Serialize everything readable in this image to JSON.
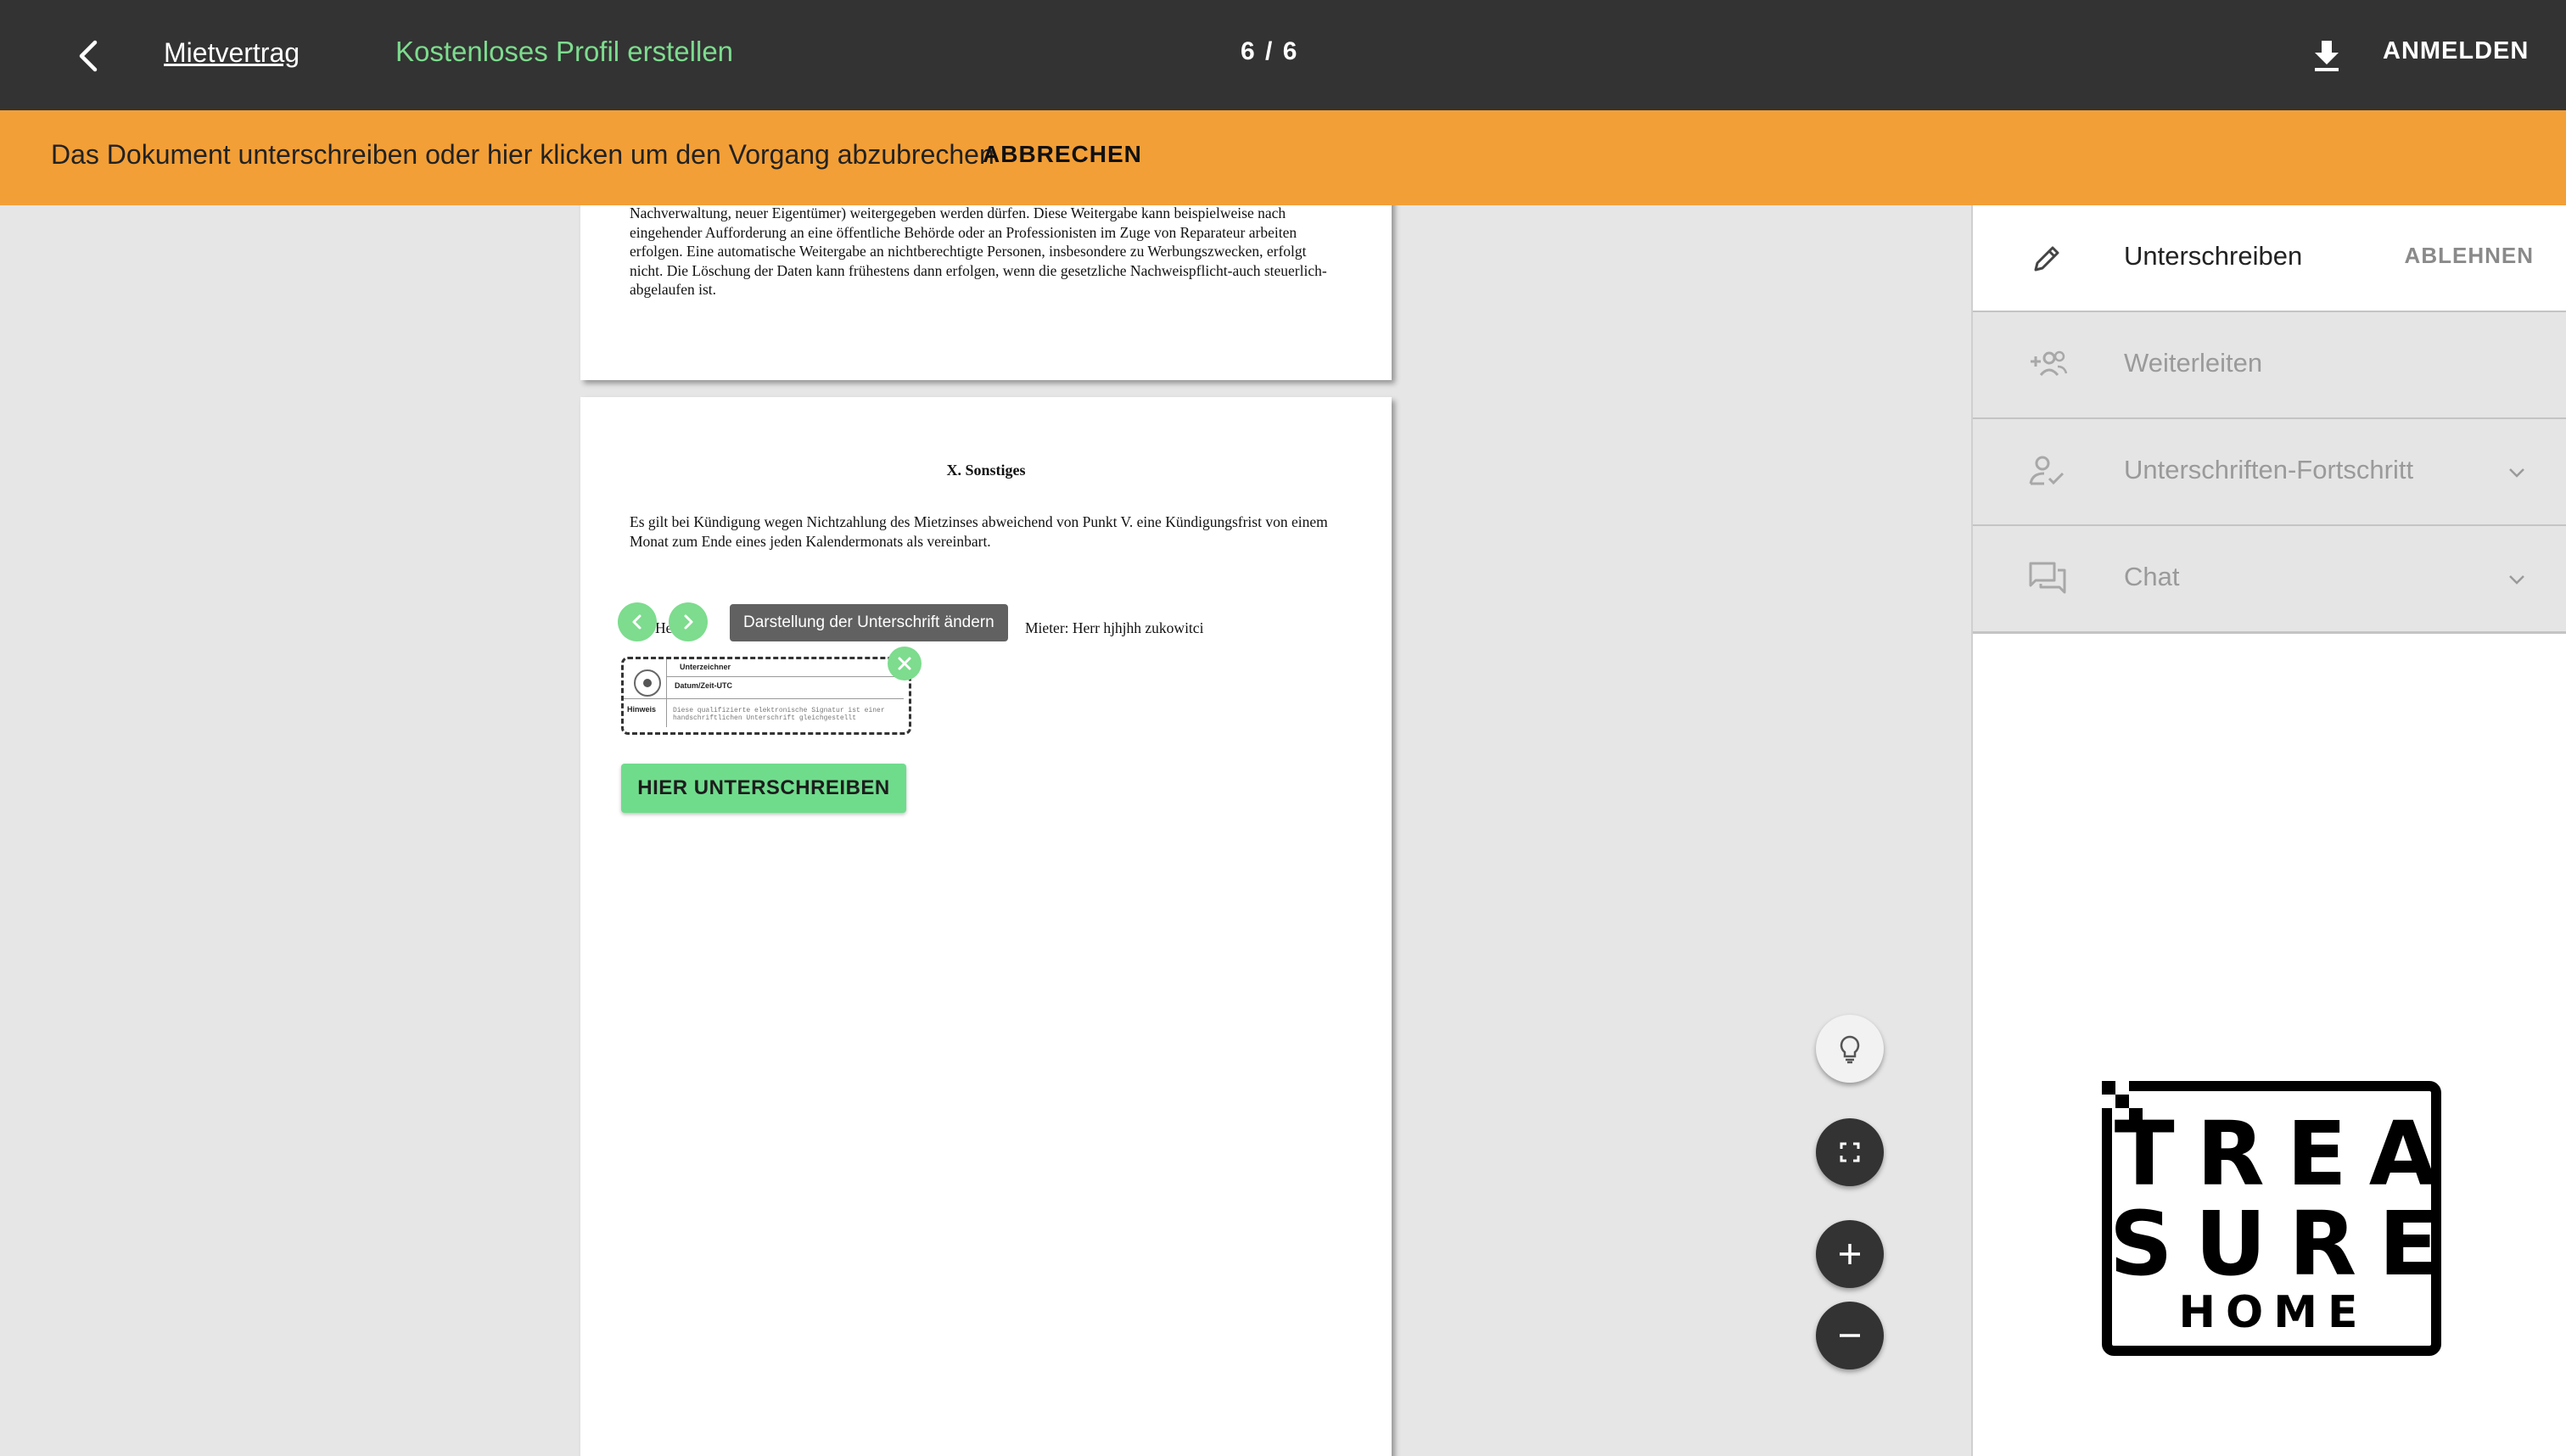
{
  "header": {
    "document_title": "Mietvertrag",
    "profile_link": "Kostenloses Profil erstellen",
    "page_counter": "6 / 6",
    "login_label": "ANMELDEN"
  },
  "banner": {
    "message": "Das Dokument unterschreiben oder hier klicken um den Vorgang abzubrechen",
    "cancel_label": "ABBRECHEN"
  },
  "document": {
    "previous_page_text": "Nachverwaltung, neuer Eigentümer) weitergegeben werden dürfen. Diese Weitergabe kann beispielweise nach eingehender Aufforderung an eine öffentliche Behörde oder an Professionisten im Zuge von Reparateur arbeiten erfolgen. Eine automatische Weitergabe an nichtberechtigte Personen, insbesondere zu Werbungszwecken, erfolgt nicht. Die Löschung der Daten kann frühestens dann erfolgen, wenn die gesetzliche Nachweispflicht-auch steuerlich-abgelaufen ist.",
    "section_heading": "X. Sonstiges",
    "section_body": "Es gilt bei Kündigung wegen Nichtzahlung des Mietzinses abweichend von Punkt V. eine Kündigungsfrist von einem Monat zum Ende eines jeden Kalendermonats als vereinbart.",
    "partial_landlord_text": "m     He",
    "tenant_line": "Mieter: Herr hjhjhh zukowitci",
    "signature_tooltip": "Darstellung der Unterschrift ändern",
    "signature_box": {
      "signer_label": "Unterzeichner",
      "datetime_label": "Datum/Zeit-UTC",
      "note_label": "Hinweis",
      "note_text": "Diese qualifizierte elektronische Signatur ist einer handschriftlichen Unterschrift gleichgestellt"
    },
    "sign_here_label": "HIER UNTERSCHREIBEN"
  },
  "sidebar": {
    "items": [
      {
        "label": "Unterschreiben",
        "action": "ABLEHNEN",
        "icon": "pencil-icon"
      },
      {
        "label": "Weiterleiten",
        "icon": "add-people-icon"
      },
      {
        "label": "Unterschriften-Fortschritt",
        "icon": "person-check-icon"
      },
      {
        "label": "Chat",
        "icon": "chat-icon"
      }
    ],
    "logo": {
      "line1": "TREA",
      "line2": "SURE",
      "line3": "HOME"
    }
  },
  "colors": {
    "topbar": "#333333",
    "banner": "#f39f37",
    "accent_green": "#7ddc8e",
    "viewer_bg": "#e6e6e6"
  }
}
